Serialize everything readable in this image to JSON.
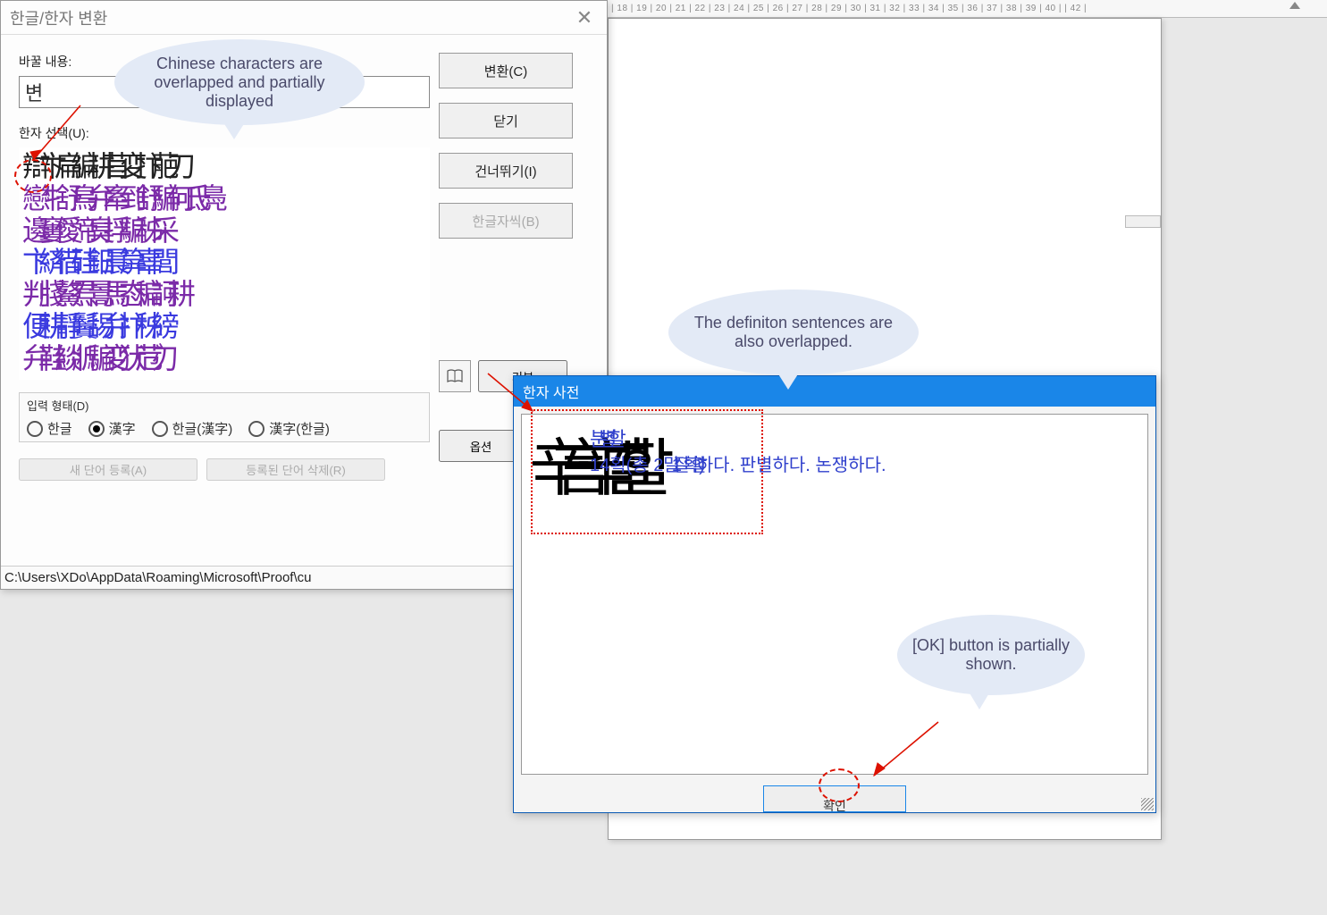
{
  "ruler": {
    "text": "| 18 | 19 | 20 | 21 | 22 | 23 | 24 | 25 | 26 | 27 | 28 | 29 | 30 | 31 | 32 | 33 | 34 | 35 | 36 | 37 | 38 | 39 | 40 |   | 42 |"
  },
  "dialog_main": {
    "title": "한글/한자 변환",
    "content_label": "바꿀 내용:",
    "content_value": "변",
    "hanja_select_label": "한자 선택(U):",
    "hanja_first": "辯",
    "hanja_rows": [
      "辯卞扁編耕苜変抃萉刀",
      "戀牜舒鳥弁牽到舒騙何氐鳧",
      "邊窶僾渧臭捊騙秭采",
      "卞緕徣硅鈤晨箳辜閭",
      "判牋鰲焄暠馬态稨訶耕",
      "便耕靜鬢舓弁抃秭縍",
      "弁鞋緂斨騙変犾苊゙刃"
    ],
    "input_style_label": "입력 형태(D)",
    "radios": {
      "r1": "한글",
      "r2": "漢字",
      "r3": "한글(漢字)",
      "r4": "漢字(한글)"
    },
    "buttons": {
      "convert": "변환(C)",
      "close": "닫기",
      "skip": "건너뛰기(I)",
      "hangul_each": "한글자씩(B)",
      "default": "기본",
      "new_word": "새 단어 등록(A)",
      "del_word": "등록된 단어 삭제(R)",
      "option": "옵션"
    },
    "path": "C:\\Users\\XDo\\AppData\\Roaming\\Microsoft\\Proof\\cu"
  },
  "dialog_dict": {
    "title": "한자 사전",
    "glyph_chars": "辛言辛별할",
    "heading": "분별할",
    "def_pre": "14획(총 2",
    "def_wrap": "말1잘획할)",
    "def_post": "하다. 판별하다. 논쟁하다.",
    "ok": "확인"
  },
  "annotations": {
    "a1": "Chinese characters are overlapped and partially displayed",
    "a2": "The definiton sentences are also overlapped.",
    "a3": "[OK] button is partially shown."
  }
}
